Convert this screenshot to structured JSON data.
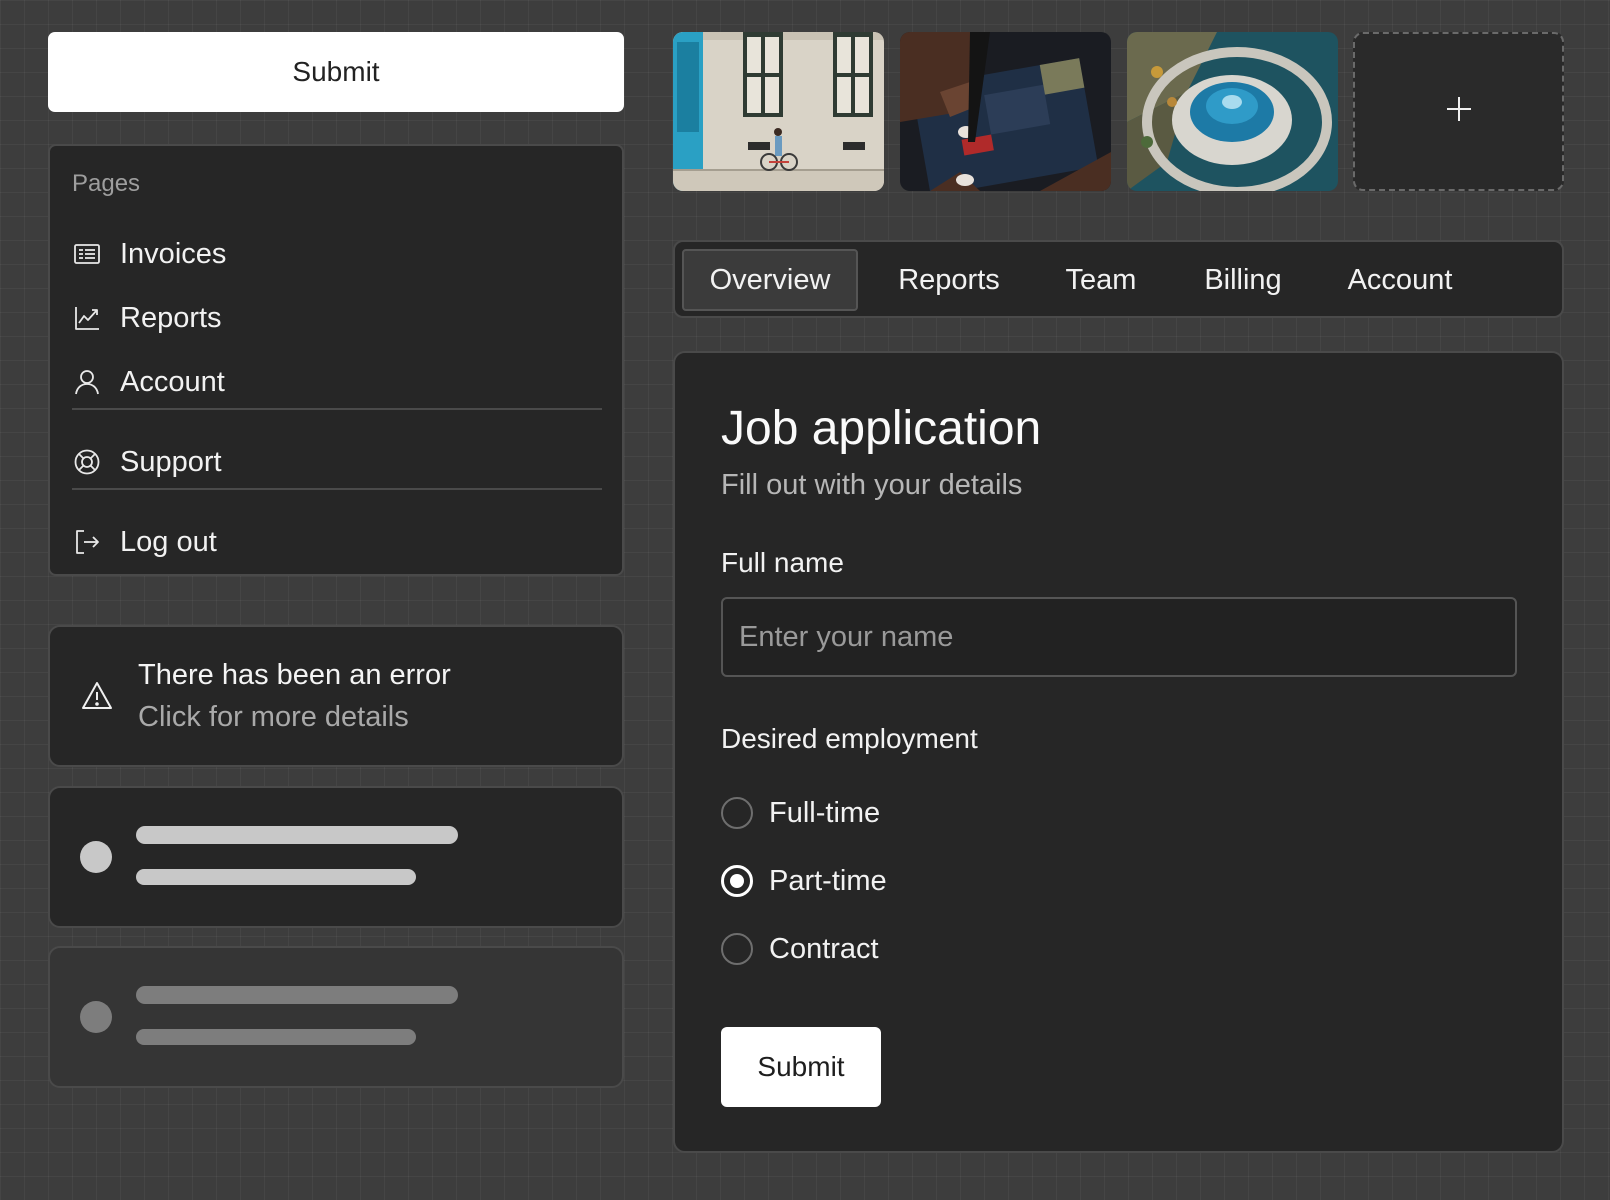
{
  "top_button": {
    "label": "Submit"
  },
  "menu": {
    "section_label": "Pages",
    "items": [
      {
        "label": "Invoices",
        "icon": "invoice-icon"
      },
      {
        "label": "Reports",
        "icon": "chart-icon"
      },
      {
        "label": "Account",
        "icon": "user-icon"
      },
      {
        "label": "Support",
        "icon": "lifebuoy-icon"
      },
      {
        "label": "Log out",
        "icon": "logout-icon"
      }
    ]
  },
  "alert": {
    "title": "There has been an error",
    "subtitle": "Click for more details",
    "icon": "warning-icon"
  },
  "gallery": {
    "images": [
      {
        "name": "building-facade-cyclist-image"
      },
      {
        "name": "circuit-board-hands-image"
      },
      {
        "name": "aerial-planetarium-image"
      }
    ],
    "add_icon": "plus-icon"
  },
  "tabs": {
    "items": [
      "Overview",
      "Reports",
      "Team",
      "Billing",
      "Account"
    ],
    "active": "Overview"
  },
  "form": {
    "title": "Job application",
    "subtitle": "Fill out with your details",
    "name_label": "Full name",
    "name_placeholder": "Enter your name",
    "name_value": "",
    "employment_label": "Desired employment",
    "options": [
      "Full-time",
      "Part-time",
      "Contract"
    ],
    "selected": "Part-time",
    "submit_label": "Submit"
  },
  "colors": {
    "background": "#3d3d3d",
    "card": "#262626",
    "border": "#4a4a4a",
    "primary_button": "#ffffff"
  }
}
